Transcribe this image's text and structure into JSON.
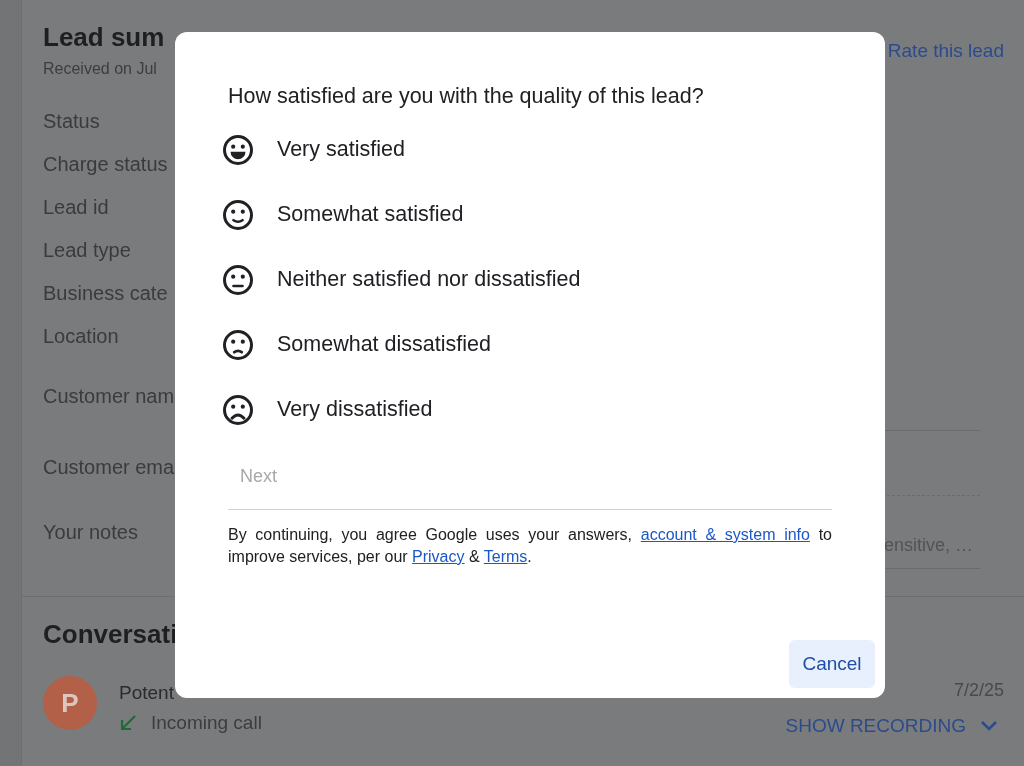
{
  "page": {
    "title": "Lead sum",
    "subtitle": "Received on Jul",
    "rate_link": "Rate this lead",
    "fields": [
      {
        "label": "Status",
        "kind": "plain"
      },
      {
        "label": "Charge status",
        "kind": "plain"
      },
      {
        "label": "Lead id",
        "kind": "plain"
      },
      {
        "label": "Lead type",
        "kind": "plain"
      },
      {
        "label": "Business cate",
        "kind": "plain"
      },
      {
        "label": "Location",
        "kind": "plain"
      },
      {
        "label": "Customer nam",
        "kind": "line"
      },
      {
        "label": "Customer ema",
        "kind": "dashed"
      },
      {
        "label": "Your notes",
        "kind": "notes",
        "value": "ensitive, …"
      }
    ],
    "conversation": {
      "title": "Conversati",
      "initial": "P",
      "name": "Potent",
      "type": "Incoming call",
      "date": "7/2/25",
      "action": "SHOW RECORDING"
    }
  },
  "dialog": {
    "question": "How satisfied are you with the quality of this lead?",
    "options": [
      {
        "label": "Very satisfied",
        "kind": "very_happy",
        "selected": false
      },
      {
        "label": "Somewhat satisfied",
        "kind": "happy",
        "selected": false
      },
      {
        "label": "Neither satisfied nor dissatisfied",
        "kind": "neutral",
        "selected": false
      },
      {
        "label": "Somewhat dissatisfied",
        "kind": "sad",
        "selected": false
      },
      {
        "label": "Very dissatisfied",
        "kind": "very_sad",
        "selected": false
      }
    ],
    "next": {
      "label": "Next",
      "disabled": true
    },
    "disclaimer": [
      {
        "text": "By continuing, you agree Google uses your answers, ",
        "kind": "text"
      },
      {
        "text": "account & system info",
        "kind": "link"
      },
      {
        "text": " to improve services, per our ",
        "kind": "text"
      },
      {
        "text": "Privacy",
        "kind": "link"
      },
      {
        "text": " & ",
        "kind": "text"
      },
      {
        "text": "Terms",
        "kind": "link"
      },
      {
        "text": ".",
        "kind": "text"
      }
    ],
    "cancel": "Cancel"
  }
}
